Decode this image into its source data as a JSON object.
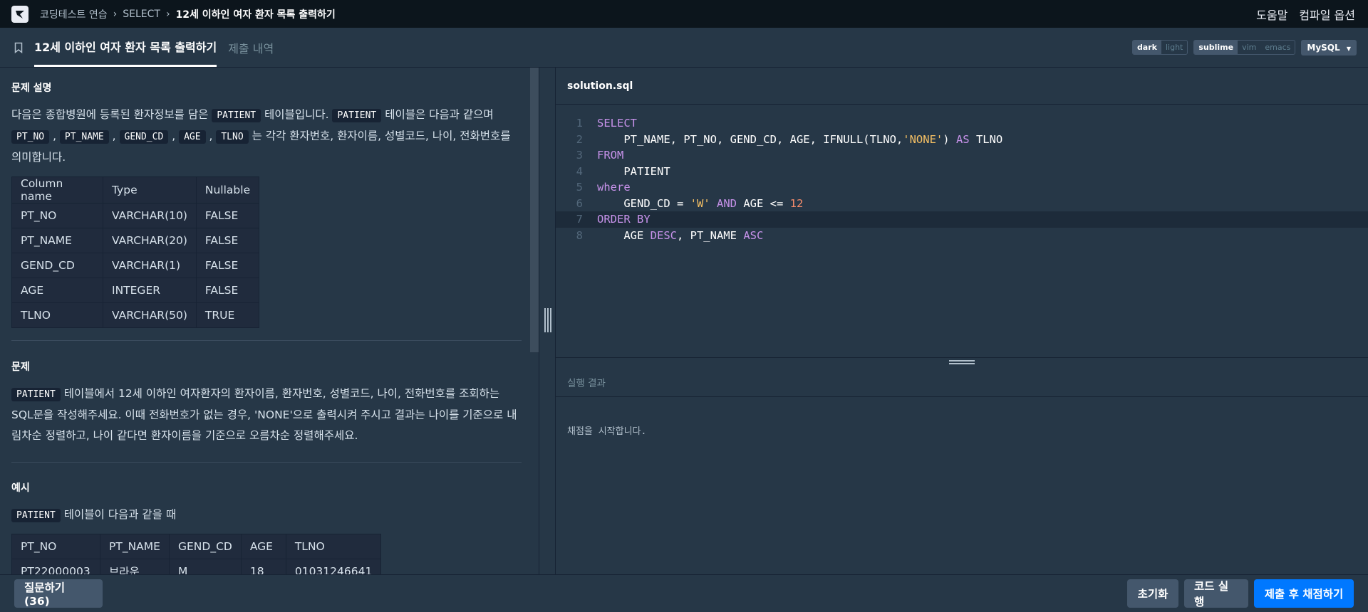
{
  "topbar": {
    "breadcrumbs": [
      "코딩테스트 연습",
      "SELECT",
      "12세 이하인 여자 환자 목록 출력하기"
    ],
    "help": "도움말",
    "compile_options": "컴파일 옵션"
  },
  "tabs": {
    "problem": "12세 이하인 여자 환자 목록 출력하기",
    "submissions": "제출 내역"
  },
  "toggles": {
    "theme": [
      "dark",
      "light"
    ],
    "keymap": [
      "sublime",
      "vim",
      "emacs"
    ],
    "language": "MySQL"
  },
  "description": {
    "heading": "문제 설명",
    "p1_a": "다음은 종합병원에 등록된 환자정보를 담은 ",
    "p1_code1": "PATIENT",
    "p1_b": " 테이블입니다. ",
    "p1_code2": "PATIENT",
    "p1_c": " 테이블은 다음과 같으며",
    "cols": [
      "PT_NO",
      "PT_NAME",
      "GEND_CD",
      "AGE",
      "TLNO"
    ],
    "p1_d": " 는 각각 환자번호, 환자이름, 성별코드, 나이, 전화번호를",
    "p1_e": "의미합니다.",
    "schema_headers": [
      "Column name",
      "Type",
      "Nullable"
    ],
    "schema_rows": [
      [
        "PT_NO",
        "VARCHAR(10)",
        "FALSE"
      ],
      [
        "PT_NAME",
        "VARCHAR(20)",
        "FALSE"
      ],
      [
        "GEND_CD",
        "VARCHAR(1)",
        "FALSE"
      ],
      [
        "AGE",
        "INTEGER",
        "FALSE"
      ],
      [
        "TLNO",
        "VARCHAR(50)",
        "TRUE"
      ]
    ]
  },
  "problem": {
    "heading": "문제",
    "code": "PATIENT",
    "line1": " 테이블에서 12세 이하인 여자환자의 환자이름, 환자번호, 성별코드, 나이, 전화번호를 조회하는",
    "line2": "SQL문을 작성해주세요. 이때 전화번호가 없는 경우, 'NONE'으로 출력시켜 주시고 결과는 나이를 기준으로 내",
    "line3": "림차순 정렬하고, 나이 같다면 환자이름을 기준으로 오름차순 정렬해주세요."
  },
  "example": {
    "heading": "예시",
    "code": "PATIENT",
    "text": " 테이블이 다음과 같을 때",
    "headers": [
      "PT_NO",
      "PT_NAME",
      "GEND_CD",
      "AGE",
      "TLNO"
    ],
    "rows": [
      [
        "PT22000003",
        "브라운",
        "M",
        "18",
        "01031246641"
      ]
    ]
  },
  "editor": {
    "filename": "solution.sql",
    "line_numbers": [
      "1",
      "2",
      "3",
      "4",
      "5",
      "6",
      "7",
      "8"
    ],
    "tokens": {
      "l1": "SELECT",
      "l2a": "    PT_NAME, PT_NO, GEND_CD, AGE, IFNULL(TLNO,",
      "l2b": "'NONE'",
      "l2c": ") ",
      "l2d": "AS",
      "l2e": " TLNO",
      "l3": "FROM",
      "l4": "    PATIENT",
      "l5": "where",
      "l6a": "    GEND_CD = ",
      "l6b": "'W'",
      "l6c": " ",
      "l6d": "AND",
      "l6e": " AGE <= ",
      "l6f": "12",
      "l7": "ORDER BY",
      "l8a": "    AGE ",
      "l8b": "DESC",
      "l8c": ", PT_NAME ",
      "l8d": "ASC"
    }
  },
  "result": {
    "heading": "실행 결과",
    "message": "채점을 시작합니다."
  },
  "bottom": {
    "ask": "질문하기 (36)",
    "reset": "초기화",
    "run": "코드 실행",
    "submit": "제출 후 채점하기"
  }
}
